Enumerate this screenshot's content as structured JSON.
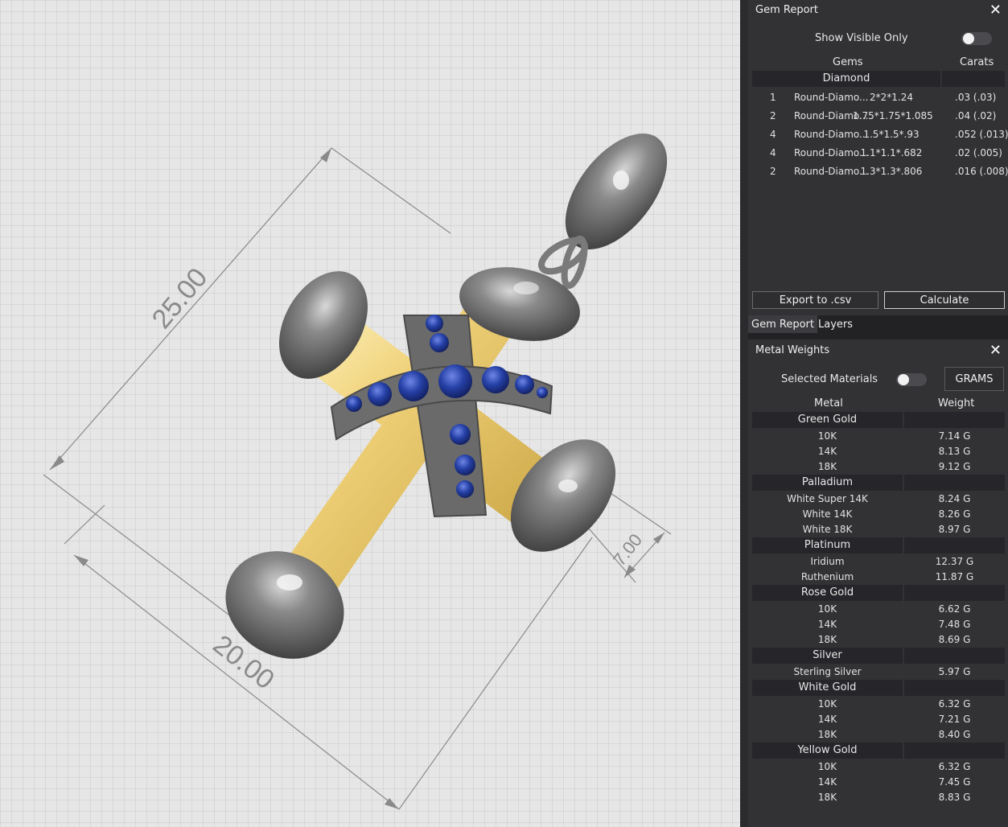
{
  "viewport": {
    "dimensions": [
      "25.00",
      "20.00",
      "7.00"
    ],
    "colors": {
      "gold": "#e6c66a",
      "metal": "#6e6e6e",
      "gem": "#2a3fa0"
    }
  },
  "gem_report": {
    "title": "Gem Report",
    "show_visible_label": "Show Visible Only",
    "col_gems": "Gems",
    "col_carats": "Carats",
    "group": "Diamond",
    "rows": [
      {
        "qty": "1",
        "name": "Round-Diamo...",
        "size": "2*2*1.24",
        "carats": ".03 (.03)"
      },
      {
        "qty": "2",
        "name": "Round-Diamo...",
        "size": "1.75*1.75*1.085",
        "carats": ".04 (.02)"
      },
      {
        "qty": "4",
        "name": "Round-Diamo...",
        "size": "1.5*1.5*.93",
        "carats": ".052 (.013)"
      },
      {
        "qty": "4",
        "name": "Round-Diamo...",
        "size": "1.1*1.1*.682",
        "carats": ".02 (.005)"
      },
      {
        "qty": "2",
        "name": "Round-Diamo...",
        "size": "1.3*1.3*.806",
        "carats": ".016 (.008)"
      }
    ],
    "export_label": "Export to .csv",
    "calculate_label": "Calculate"
  },
  "tabs": [
    "Gem Report",
    "Layers"
  ],
  "metal_weights": {
    "title": "Metal Weights",
    "selected_label": "Selected Materials",
    "units_label": "GRAMS",
    "col_metal": "Metal",
    "col_weight": "Weight",
    "groups": [
      {
        "name": "Green Gold",
        "items": [
          {
            "label": "10K",
            "weight": "7.14 G"
          },
          {
            "label": "14K",
            "weight": "8.13 G"
          },
          {
            "label": "18K",
            "weight": "9.12 G"
          }
        ]
      },
      {
        "name": "Palladium",
        "items": [
          {
            "label": "White Super 14K",
            "weight": "8.24 G"
          },
          {
            "label": "White 14K",
            "weight": "8.26 G"
          },
          {
            "label": "White 18K",
            "weight": "8.97 G"
          }
        ]
      },
      {
        "name": "Platinum",
        "items": [
          {
            "label": "Iridium",
            "weight": "12.37 G"
          },
          {
            "label": "Ruthenium",
            "weight": "11.87 G"
          }
        ]
      },
      {
        "name": "Rose Gold",
        "items": [
          {
            "label": "10K",
            "weight": "6.62 G"
          },
          {
            "label": "14K",
            "weight": "7.48 G"
          },
          {
            "label": "18K",
            "weight": "8.69 G"
          }
        ]
      },
      {
        "name": "Silver",
        "items": [
          {
            "label": "Sterling Silver",
            "weight": "5.97 G"
          }
        ]
      },
      {
        "name": "White Gold",
        "items": [
          {
            "label": "10K",
            "weight": "6.32 G"
          },
          {
            "label": "14K",
            "weight": "7.21 G"
          },
          {
            "label": "18K",
            "weight": "8.40 G"
          }
        ]
      },
      {
        "name": "Yellow Gold",
        "items": [
          {
            "label": "10K",
            "weight": "6.32 G"
          },
          {
            "label": "14K",
            "weight": "7.45 G"
          },
          {
            "label": "18K",
            "weight": "8.83 G"
          }
        ]
      }
    ]
  }
}
